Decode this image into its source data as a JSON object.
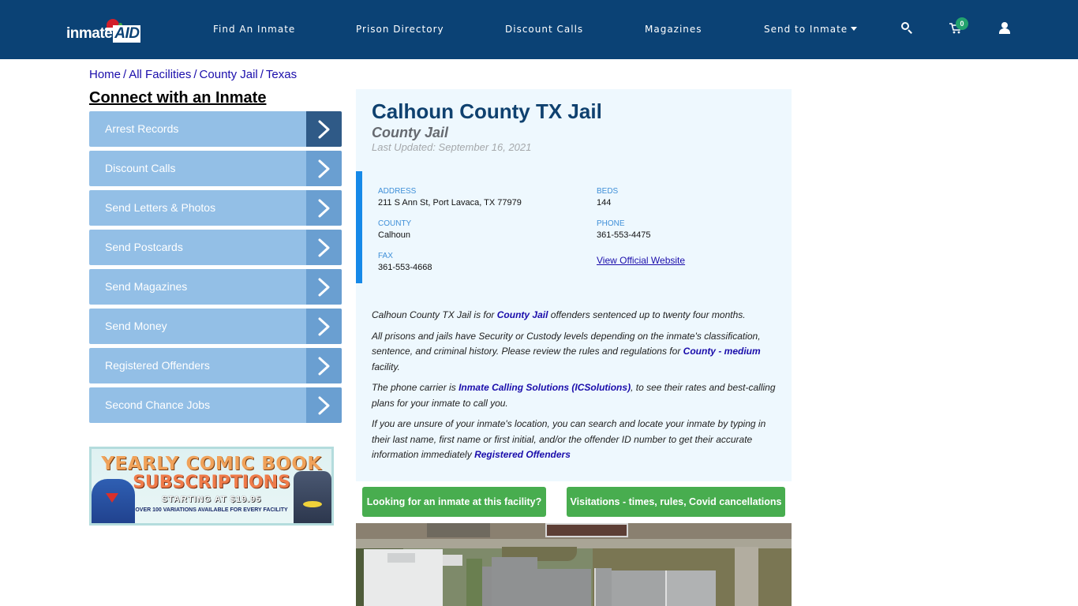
{
  "brand": {
    "logo_text": "inmate",
    "logo_accent": "AID",
    "nav_bg": "#0b4275"
  },
  "nav": {
    "links": [
      {
        "label": "Find An Inmate"
      },
      {
        "label": "Prison Directory"
      },
      {
        "label": "Discount Calls"
      },
      {
        "label": "Magazines"
      },
      {
        "label": "Send to Inmate"
      }
    ],
    "cart_count": "0",
    "icons": [
      "search-icon",
      "cart-icon",
      "user-icon"
    ]
  },
  "breadcrumb": [
    {
      "label": "Home"
    },
    {
      "label": "All Facilities"
    },
    {
      "label": "County Jail"
    },
    {
      "label": "Texas"
    }
  ],
  "breadcrumb_sep": "/",
  "sidebar": {
    "title": "Connect with an Inmate",
    "items": [
      {
        "label": "Arrest Records"
      },
      {
        "label": "Discount Calls"
      },
      {
        "label": "Send Letters & Photos"
      },
      {
        "label": "Send Postcards"
      },
      {
        "label": "Send Magazines"
      },
      {
        "label": "Send Money"
      },
      {
        "label": "Registered Offenders"
      },
      {
        "label": "Second Chance Jobs"
      }
    ],
    "ad": {
      "line1": "YEARLY COMIC BOOK",
      "line2": "SUBSCRIPTIONS",
      "line3": "STARTING AT $19.95",
      "line4": "OVER 100 VARIATIONS AVAILABLE FOR EVERY FACILITY"
    }
  },
  "facility": {
    "title": "Calhoun County TX Jail",
    "type": "County Jail",
    "last_updated": "Last Updated: September 16, 2021",
    "info": {
      "address_label": "ADDRESS",
      "address": "211 S Ann St, Port Lavaca, TX 77979",
      "beds_label": "BEDS",
      "beds": "144",
      "county_label": "COUNTY",
      "county": "Calhoun",
      "phone_label": "PHONE",
      "phone": "361-553-4475",
      "fax_label": "FAX",
      "fax": "361-553-4668",
      "website_link": "View Official Website"
    },
    "description": {
      "p1_pre": "Calhoun County TX Jail is for ",
      "p1_link": "County Jail",
      "p1_post": " offenders sentenced up to twenty four months.",
      "p2_pre": "All prisons and jails have Security or Custody levels depending on the inmate's classification, sentence, and criminal history. Please review the rules and regulations for ",
      "p2_link": "County - medium",
      "p2_post": " facility.",
      "p3_pre": "The phone carrier is ",
      "p3_link": "Inmate Calling Solutions (ICSolutions)",
      "p3_post": ", to see their rates and best-calling plans for your inmate to call you.",
      "p4_pre": "If you are unsure of your inmate's location, you can search and locate your inmate by typing in their last name, first name or first initial, and/or the offender ID number to get their accurate information immediately ",
      "p4_link": "Registered Offenders"
    },
    "buttons": {
      "find_inmate": "Looking for an inmate at this facility?",
      "visitation": "Visitations - times, rules, Covid cancellations"
    }
  },
  "colors": {
    "title": "#0f416f",
    "sidebar_item": "#93bfe6",
    "sidebar_arrow": "#6a9fd1",
    "sidebar_arrow_active": "#2f5a87",
    "info_accent": "#1689e8",
    "green_button": "#48ad4f",
    "link": "#1a0dab"
  }
}
